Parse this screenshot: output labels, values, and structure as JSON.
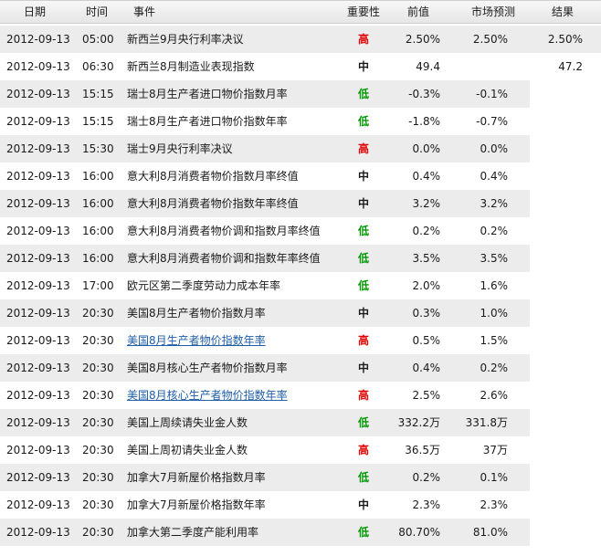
{
  "header": {
    "date": "日期",
    "time": "时间",
    "event": "事件",
    "importance": "重要性",
    "previous": "前值",
    "forecast": "市场预测",
    "actual": "结果"
  },
  "importance_colors": {
    "high": "#e00000",
    "medium": "#0000b8",
    "low": "#009900"
  },
  "link_color": "#1f5ea8",
  "rows": [
    {
      "date": "2012-09-13",
      "time": "05:00",
      "event": "新西兰9月央行利率决议",
      "importance": "高",
      "level": "high",
      "previous": "2.50%",
      "forecast": "2.50%",
      "actual": "2.50%",
      "link": false
    },
    {
      "date": "2012-09-13",
      "time": "06:30",
      "event": "新西兰8月制造业表现指数",
      "importance": "中",
      "level": "medium",
      "previous": "49.4",
      "forecast": "",
      "actual": "47.2",
      "link": false
    },
    {
      "date": "2012-09-13",
      "time": "15:15",
      "event": "瑞士8月生产者进口物价指数月率",
      "importance": "低",
      "level": "low",
      "previous": "-0.3%",
      "forecast": "-0.1%",
      "actual": "",
      "link": false
    },
    {
      "date": "2012-09-13",
      "time": "15:15",
      "event": "瑞士8月生产者进口物价指数年率",
      "importance": "低",
      "level": "low",
      "previous": "-1.8%",
      "forecast": "-0.7%",
      "actual": "",
      "link": false
    },
    {
      "date": "2012-09-13",
      "time": "15:30",
      "event": "瑞士9月央行利率决议",
      "importance": "高",
      "level": "high",
      "previous": "0.0%",
      "forecast": "0.0%",
      "actual": "",
      "link": false
    },
    {
      "date": "2012-09-13",
      "time": "16:00",
      "event": "意大利8月消费者物价指数月率终值",
      "importance": "中",
      "level": "medium",
      "previous": "0.4%",
      "forecast": "0.4%",
      "actual": "",
      "link": false
    },
    {
      "date": "2012-09-13",
      "time": "16:00",
      "event": "意大利8月消费者物价指数年率终值",
      "importance": "中",
      "level": "medium",
      "previous": "3.2%",
      "forecast": "3.2%",
      "actual": "",
      "link": false
    },
    {
      "date": "2012-09-13",
      "time": "16:00",
      "event": "意大利8月消费者物价调和指数月率终值",
      "importance": "低",
      "level": "low",
      "previous": "0.2%",
      "forecast": "0.2%",
      "actual": "",
      "link": false
    },
    {
      "date": "2012-09-13",
      "time": "16:00",
      "event": "意大利8月消费者物价调和指数年率终值",
      "importance": "低",
      "level": "low",
      "previous": "3.5%",
      "forecast": "3.5%",
      "actual": "",
      "link": false
    },
    {
      "date": "2012-09-13",
      "time": "17:00",
      "event": "欧元区第二季度劳动力成本年率",
      "importance": "低",
      "level": "low",
      "previous": "2.0%",
      "forecast": "1.6%",
      "actual": "",
      "link": false
    },
    {
      "date": "2012-09-13",
      "time": "20:30",
      "event": "美国8月生产者物价指数月率",
      "importance": "中",
      "level": "medium",
      "previous": "0.3%",
      "forecast": "1.0%",
      "actual": "",
      "link": false
    },
    {
      "date": "2012-09-13",
      "time": "20:30",
      "event": "美国8月生产者物价指数年率",
      "importance": "高",
      "level": "high",
      "previous": "0.5%",
      "forecast": "1.5%",
      "actual": "",
      "link": true
    },
    {
      "date": "2012-09-13",
      "time": "20:30",
      "event": "美国8月核心生产者物价指数月率",
      "importance": "中",
      "level": "medium",
      "previous": "0.4%",
      "forecast": "0.2%",
      "actual": "",
      "link": false
    },
    {
      "date": "2012-09-13",
      "time": "20:30",
      "event": "美国8月核心生产者物价指数年率",
      "importance": "高",
      "level": "high",
      "previous": "2.5%",
      "forecast": "2.6%",
      "actual": "",
      "link": true
    },
    {
      "date": "2012-09-13",
      "time": "20:30",
      "event": "美国上周续请失业金人数",
      "importance": "低",
      "level": "low",
      "previous": "332.2万",
      "forecast": "331.8万",
      "actual": "",
      "link": false
    },
    {
      "date": "2012-09-13",
      "time": "20:30",
      "event": "美国上周初请失业金人数",
      "importance": "高",
      "level": "high",
      "previous": "36.5万",
      "forecast": "37万",
      "actual": "",
      "link": false
    },
    {
      "date": "2012-09-13",
      "time": "20:30",
      "event": "加拿大7月新屋价格指数月率",
      "importance": "低",
      "level": "low",
      "previous": "0.2%",
      "forecast": "0.1%",
      "actual": "",
      "link": false
    },
    {
      "date": "2012-09-13",
      "time": "20:30",
      "event": "加拿大7月新屋价格指数年率",
      "importance": "中",
      "level": "medium",
      "previous": "2.3%",
      "forecast": "2.3%",
      "actual": "",
      "link": false
    },
    {
      "date": "2012-09-13",
      "time": "20:30",
      "event": "加拿大第二季度产能利用率",
      "importance": "低",
      "level": "low",
      "previous": "80.70%",
      "forecast": "81.0%",
      "actual": "",
      "link": false
    }
  ]
}
